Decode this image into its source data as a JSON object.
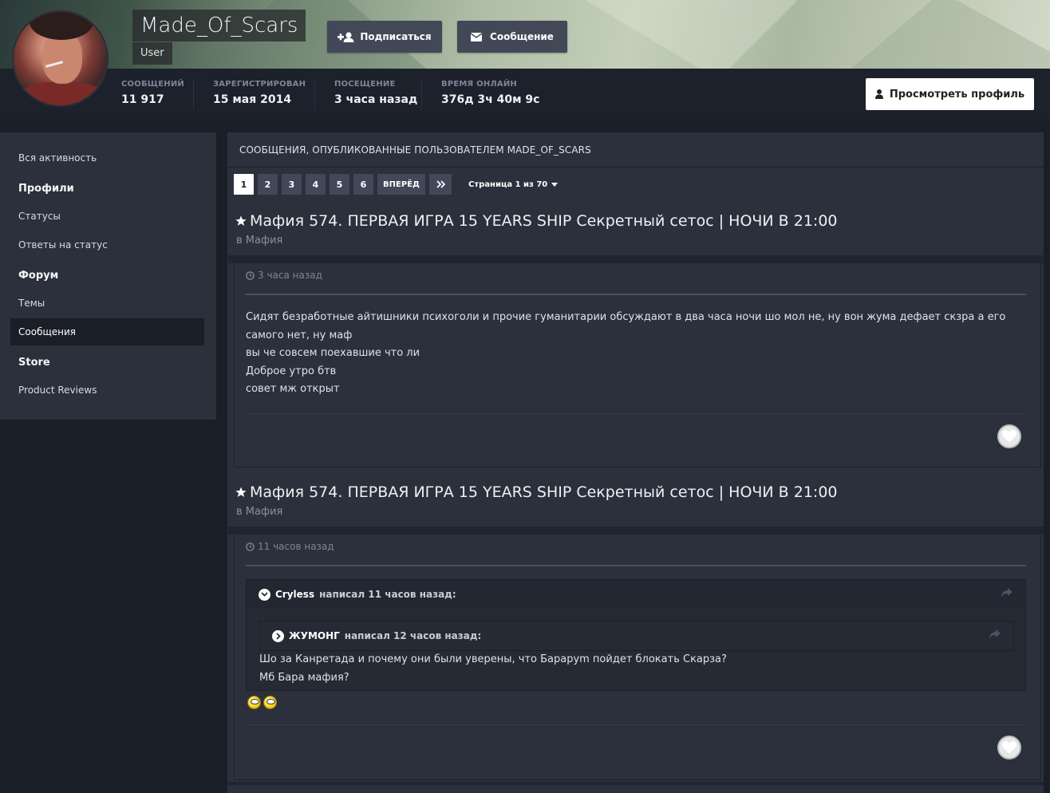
{
  "profile": {
    "username": "Made_Of_Scars",
    "group": "User",
    "follow_label": "Подписаться",
    "message_label": "Сообщение",
    "view_profile_label": "Просмотреть профиль",
    "stats": [
      {
        "label": "СООБЩЕНИЙ",
        "value": "11 917"
      },
      {
        "label": "ЗАРЕГИСТРИРОВАН",
        "value": "15 мая 2014"
      },
      {
        "label": "ПОСЕЩЕНИЕ",
        "value": "3 часа назад"
      },
      {
        "label": "ВРЕМЯ ОНЛАЙН",
        "value": "376д 3ч 40м 9с"
      }
    ]
  },
  "sidebar": {
    "items": [
      {
        "label": "Вся активность"
      },
      {
        "label": "Профили"
      },
      {
        "label": "Статусы"
      },
      {
        "label": "Ответы на статус"
      },
      {
        "label": "Форум"
      },
      {
        "label": "Темы"
      },
      {
        "label": "Сообщения"
      },
      {
        "label": "Store"
      },
      {
        "label": "Product Reviews"
      }
    ]
  },
  "main": {
    "title": "СООБЩЕНИЯ, ОПУБЛИКОВАННЫЕ ПОЛЬЗОВАТЕЛЕМ MADE_OF_SCARS",
    "pagination": {
      "pages": [
        "1",
        "2",
        "3",
        "4",
        "5",
        "6"
      ],
      "next_label": "ВПЕРЁД",
      "info": "Страница 1 из 70"
    },
    "posts": [
      {
        "title": "Мафия 574. ПЕРВАЯ ИГРА 15 YEARS SHIP Секретный сетос | НОЧИ В 21:00",
        "forum": "в Мафия",
        "time": "3 часа назад",
        "lines": [
          "Сидят безработные айтишники психоголи и прочие гуманитарии обсуждают в два часа ночи шо мол не, ну вон жума дефает скзра а его самого нет, ну маф",
          "вы че совсем поехавшие что ли",
          "Доброе утро бтв",
          "совет мж открыт"
        ]
      },
      {
        "title": "Мафия 574. ПЕРВАЯ ИГРА 15 YEARS SHIP Секретный сетос | НОЧИ В 21:00",
        "forum": "в Мафия",
        "time": "11 часов назад",
        "quote": {
          "author": "Cryless",
          "wrote": "написал 11 часов назад:",
          "inner": {
            "author": "ЖУМОНГ",
            "wrote": "написал 12 часов назад:"
          },
          "lines": [
            "Шо за Канретада и почему они были уверены, что Бараруm пойдет блокать Скарза?",
            "Мб Бара мафия?"
          ]
        }
      }
    ]
  }
}
